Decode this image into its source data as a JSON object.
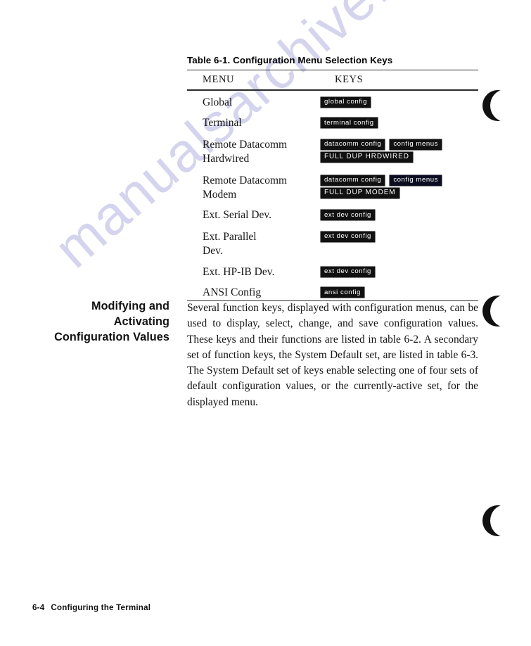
{
  "watermark": {
    "text": "manualsarchive.com"
  },
  "table": {
    "title": "Table 6-1.  Configuration Menu Selection Keys",
    "columns": {
      "menu": "MENU",
      "keys": "KEYS"
    },
    "rows": [
      {
        "menu": "Global",
        "keys": [
          [
            "global config"
          ]
        ]
      },
      {
        "menu": "Terminal",
        "keys": [
          [
            "terminal config"
          ]
        ]
      },
      {
        "menu": "Remote Datacomm\nHardwired",
        "keys": [
          [
            "datacomm config",
            "config menus"
          ],
          [
            "FULL DUP HRDWIRED"
          ]
        ]
      },
      {
        "menu": "Remote Datacomm\nModem",
        "keys": [
          [
            "datacomm config",
            "config menus"
          ],
          [
            "FULL DUP MODEM"
          ]
        ]
      },
      {
        "menu": "Ext. Serial Dev.",
        "keys": [
          [
            "ext dev config"
          ]
        ]
      },
      {
        "menu": "Ext. Parallel\nDev.",
        "keys": [
          [
            "ext dev config"
          ]
        ]
      },
      {
        "menu": "Ext. HP-IB Dev.",
        "keys": [
          [
            "ext dev config"
          ]
        ]
      },
      {
        "menu": "ANSI Config",
        "keys": [
          [
            "ansi config"
          ]
        ]
      }
    ]
  },
  "section": {
    "heading": "Modifying and Activating Configuration Values",
    "body": "Several function keys, displayed with configuration menus, can be used to display, select, change, and save configuration values. These keys and their functions are listed in table 6-2. A secondary set of function keys, the System Default set, are listed in table 6-3. The System Default set of keys enable selecting one of four sets of default configuration values, or the currently-active set, for the displayed menu."
  },
  "footer": {
    "page_number": "6-4",
    "chapter_title": "Configuring the Terminal"
  },
  "colors": {
    "key_background": "#111111",
    "key_text": "#ffffff",
    "watermark": "#c8c8ea",
    "rule": "#2a2a2a"
  }
}
